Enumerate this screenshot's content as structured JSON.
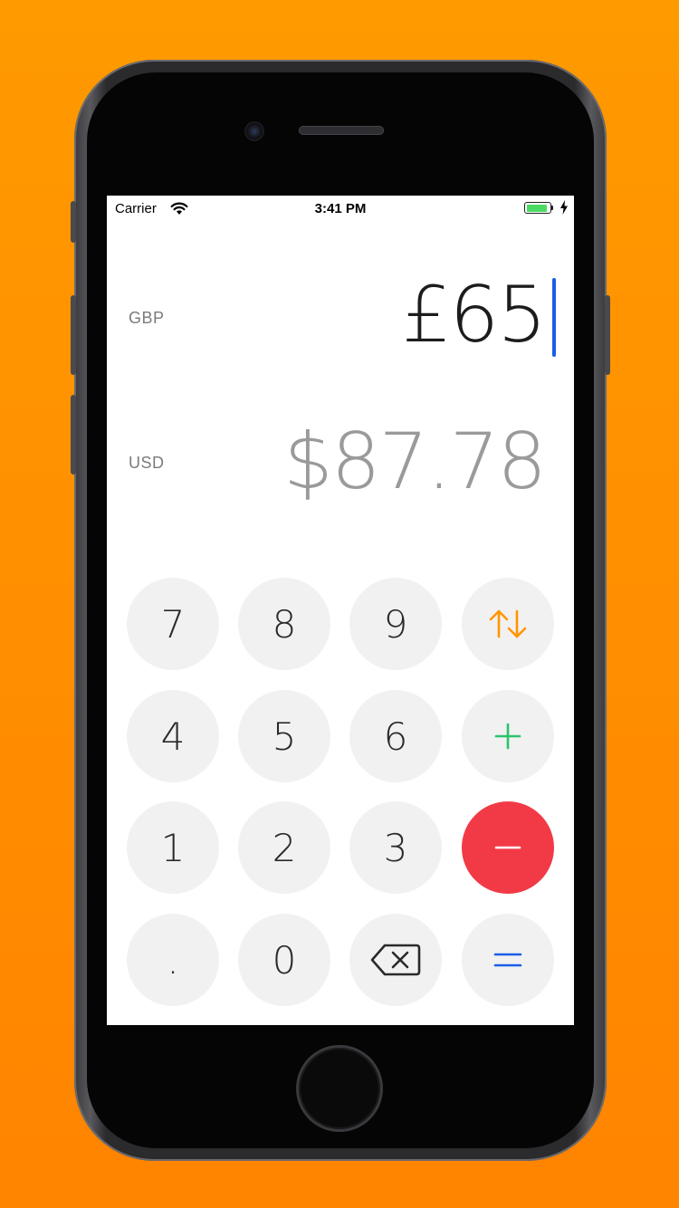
{
  "status_bar": {
    "carrier": "Carrier",
    "time": "3:41 PM",
    "battery_level_fraction": 0.92,
    "battery_color": "#4cd964"
  },
  "converter": {
    "from": {
      "currency": "GBP",
      "amount": "£65"
    },
    "to": {
      "currency": "USD",
      "amount": "$87.78"
    },
    "cursor_color": "#1a5ee8"
  },
  "keypad": {
    "digits": {
      "seven": "7",
      "eight": "8",
      "nine": "9",
      "four": "4",
      "five": "5",
      "six": "6",
      "one": "1",
      "two": "2",
      "three": "3",
      "decimal": ".",
      "zero": "0"
    },
    "operators": {
      "swap": {
        "icon": "swap-arrows-icon",
        "color": "#ff9500"
      },
      "plus": {
        "icon": "plus-icon",
        "color": "#2bc36b"
      },
      "minus": {
        "icon": "minus-icon",
        "color": "#f23a47"
      },
      "equals": {
        "icon": "equals-icon",
        "color": "#1a5ee8"
      },
      "backspace": {
        "icon": "backspace-icon"
      }
    }
  },
  "colors": {
    "background_orange": "#ff8f00",
    "key_background": "#f1f1f1"
  }
}
